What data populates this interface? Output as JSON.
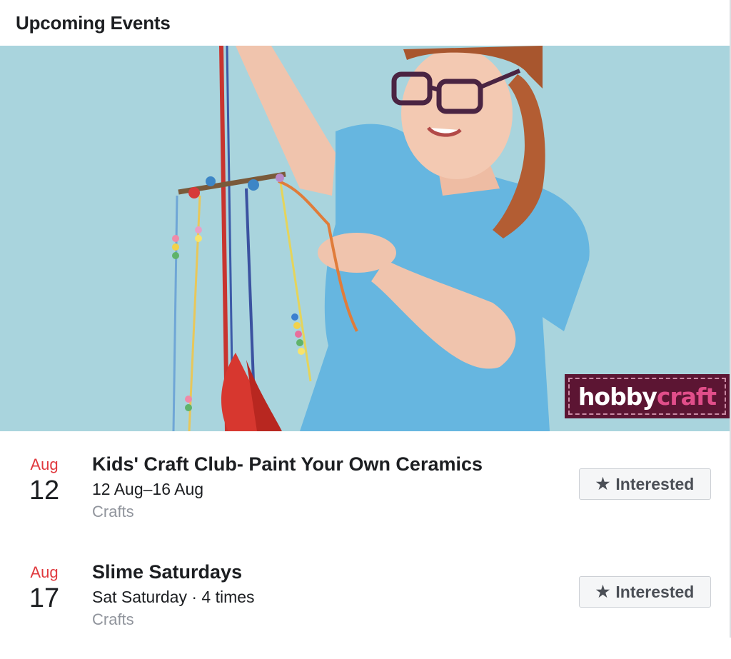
{
  "header": {
    "title": "Upcoming Events"
  },
  "hero": {
    "brand_part1": "hobby",
    "brand_part2": "craft"
  },
  "events": [
    {
      "month": "Aug",
      "day": "12",
      "title": "Kids' Craft Club- Paint Your Own Ceramics",
      "when": "12 Aug–16 Aug",
      "category": "Crafts",
      "button_label": "Interested",
      "button_icon": "star-icon"
    },
    {
      "month": "Aug",
      "day": "17",
      "title": "Slime Saturdays",
      "when": "Sat Saturday · 4 times",
      "category": "Crafts",
      "button_label": "Interested",
      "button_icon": "star-icon"
    }
  ],
  "colors": {
    "month_red": "#e0393e",
    "hero_background": "#a9d4dd",
    "brand_maroon": "#5c1533",
    "brand_pink": "#e14e8a",
    "muted_text": "#90949c"
  }
}
